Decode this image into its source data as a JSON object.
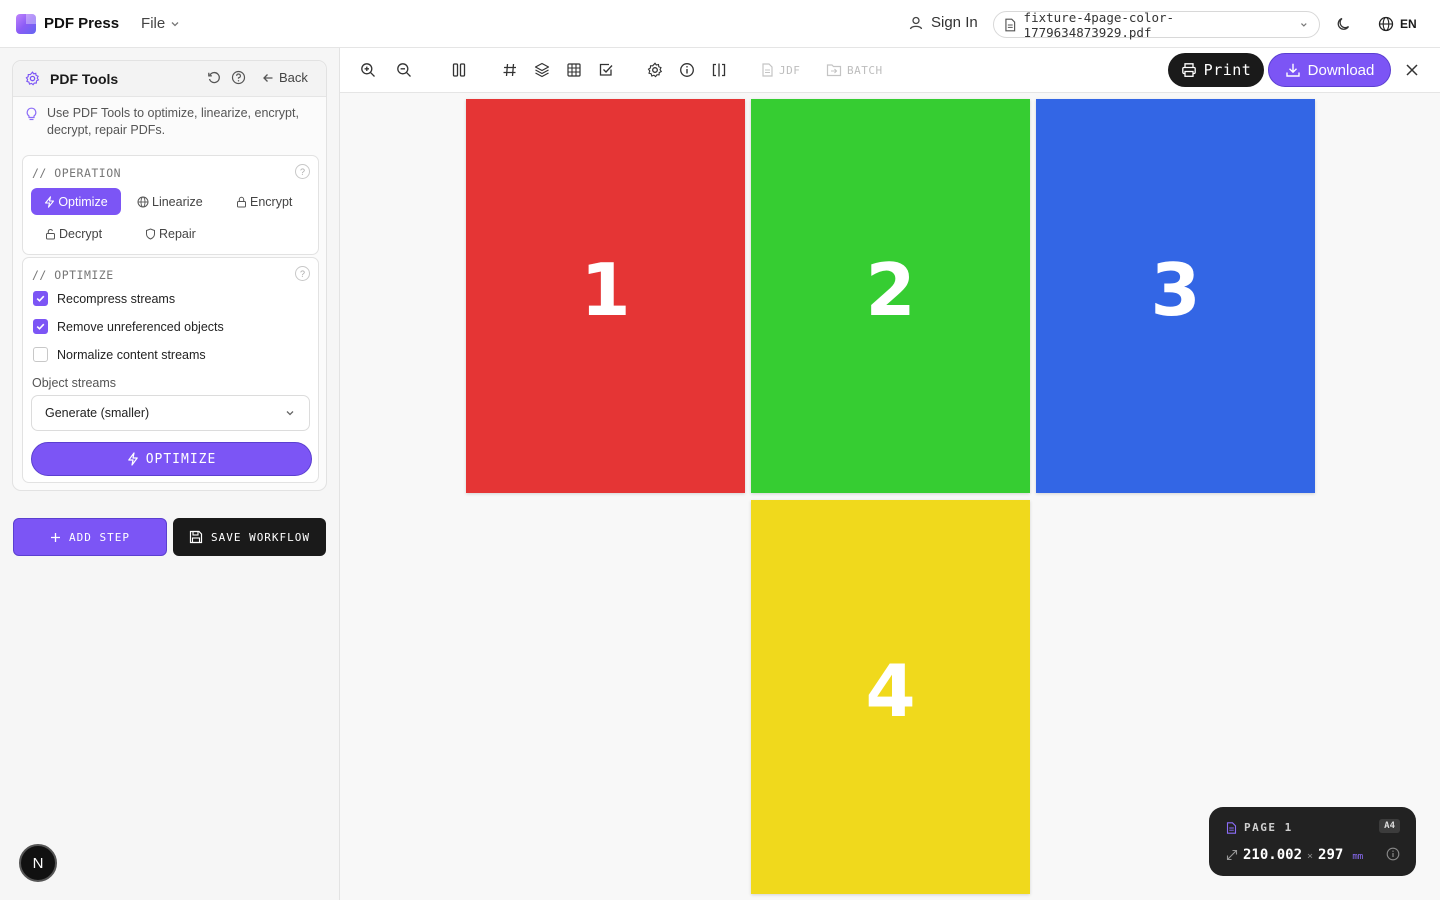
{
  "app": {
    "name": "PDF Press",
    "file_menu": "File",
    "sign_in": "Sign In",
    "filename": "fixture-4page-color-1779634873929.pdf",
    "language": "EN"
  },
  "sidebar": {
    "title": "PDF Tools",
    "back_label": "Back",
    "hint": "Use PDF Tools to optimize, linearize, encrypt, decrypt, repair PDFs.",
    "operation_label": "// OPERATION",
    "operations": [
      {
        "label": "Optimize",
        "icon": "bolt-icon",
        "active": true
      },
      {
        "label": "Linearize",
        "icon": "globe-icon",
        "active": false
      },
      {
        "label": "Encrypt",
        "icon": "lock-icon",
        "active": false
      },
      {
        "label": "Decrypt",
        "icon": "unlock-icon",
        "active": false
      },
      {
        "label": "Repair",
        "icon": "shield-icon",
        "active": false
      }
    ],
    "optimize_label": "// OPTIMIZE",
    "options": [
      {
        "label": "Recompress streams",
        "checked": true
      },
      {
        "label": "Remove unreferenced objects",
        "checked": true
      },
      {
        "label": "Normalize content streams",
        "checked": false
      }
    ],
    "object_streams_label": "Object streams",
    "object_streams_value": "Generate (smaller)",
    "optimize_button": "OPTIMIZE",
    "add_step": "ADD STEP",
    "save_workflow": "SAVE WORKFLOW",
    "badge": "N"
  },
  "toolbar": {
    "jdf_label": "JDF",
    "batch_label": "BATCH",
    "print_label": "Print",
    "download_label": "Download"
  },
  "pages": [
    {
      "number": "1",
      "color": "#e53535"
    },
    {
      "number": "2",
      "color": "#36cd32"
    },
    {
      "number": "3",
      "color": "#3366e5"
    },
    {
      "number": "4",
      "color": "#f0d91c"
    }
  ],
  "page_info": {
    "label": "PAGE 1",
    "size_name": "A4",
    "width": "210.002",
    "separator": "×",
    "height": "297",
    "unit": "mm"
  },
  "colors": {
    "accent": "#7c55f5",
    "dark": "#1a1a1a"
  }
}
